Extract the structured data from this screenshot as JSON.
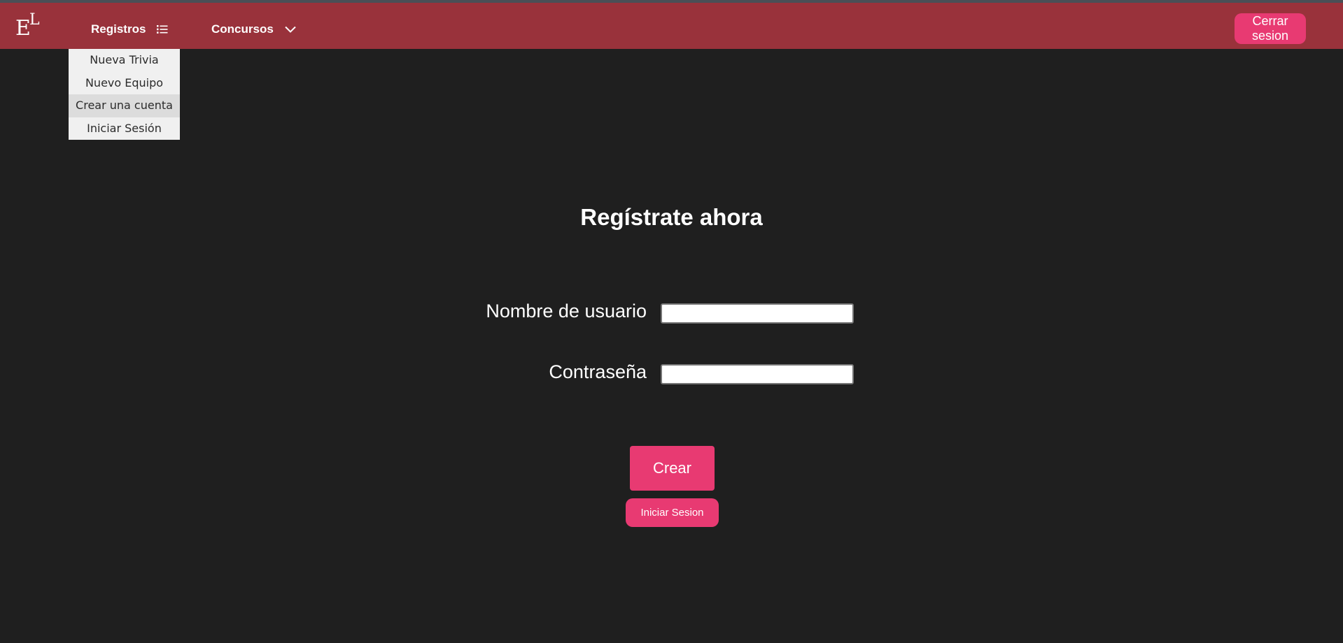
{
  "logo": {
    "big": "E",
    "small": "L"
  },
  "nav": {
    "registros_label": "Registros",
    "registros_icon": "list-icon",
    "concursos_label": "Concursos",
    "concursos_icon": "chevron-down-icon",
    "logout_label": "Cerrar sesion"
  },
  "dropdown": {
    "items": [
      {
        "label": "Nueva Trivia"
      },
      {
        "label": "Nuevo Equipo"
      },
      {
        "label": "Crear una cuenta"
      },
      {
        "label": "Iniciar Sesión"
      }
    ]
  },
  "form": {
    "title": "Regístrate ahora",
    "username_label": "Nombre de usuario",
    "username_value": "",
    "password_label": "Contraseña",
    "password_value": "",
    "submit_label": "Crear",
    "login_label": "Iniciar Sesion"
  },
  "colors": {
    "navbar": "#99323b",
    "background": "#1f1f1f",
    "accent": "#e83a72"
  }
}
